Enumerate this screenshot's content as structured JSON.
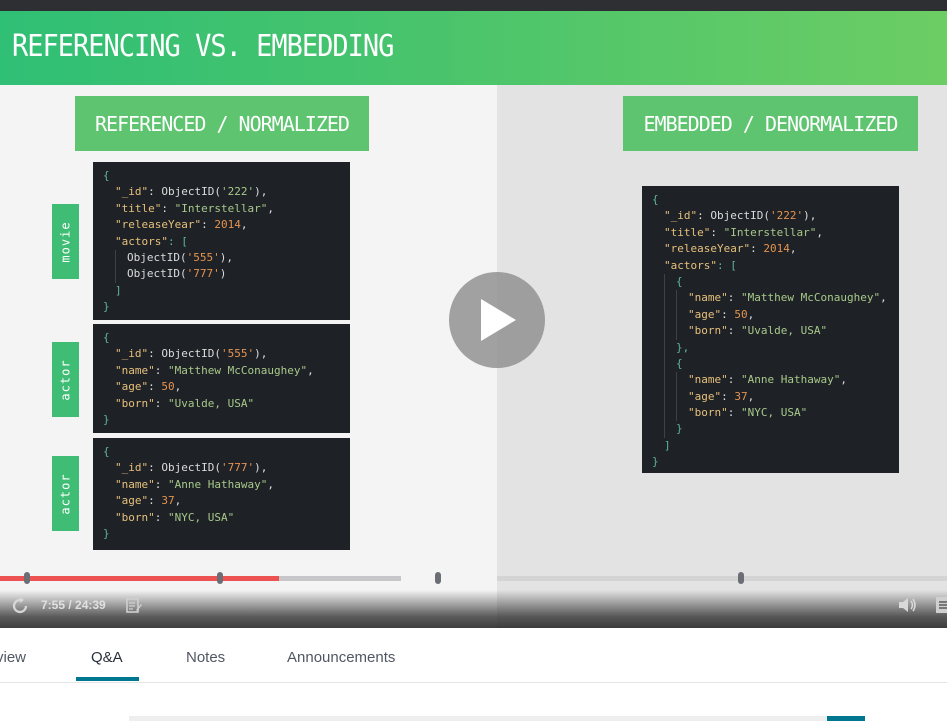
{
  "slide": {
    "title": "REFERENCING VS. EMBEDDING",
    "left_header": "REFERENCED / NORMALIZED",
    "right_header": "EMBEDDED / DENORMALIZED",
    "labels": [
      "movie",
      "actor",
      "actor"
    ]
  },
  "code_blocks": {
    "movie": [
      [
        {
          "t": "{",
          "c": "p"
        }
      ],
      [
        {
          "t": "\"_id\"",
          "c": "k"
        },
        {
          "t": ": ObjectID(",
          "c": "f"
        },
        {
          "t": "'222'",
          "c": "s"
        },
        {
          "t": "),",
          "c": "f"
        }
      ],
      [
        {
          "t": "\"title\"",
          "c": "k"
        },
        {
          "t": ": ",
          "c": "f"
        },
        {
          "t": "\"Interstellar\"",
          "c": "s"
        },
        {
          "t": ",",
          "c": "f"
        }
      ],
      [
        {
          "t": "\"releaseYear\"",
          "c": "k"
        },
        {
          "t": ": ",
          "c": "f"
        },
        {
          "t": "2014",
          "c": "n"
        },
        {
          "t": ",",
          "c": "f"
        }
      ],
      [
        {
          "t": "\"actors\"",
          "c": "k"
        },
        {
          "t": ": [",
          "c": "p"
        }
      ],
      [
        {
          "t": "ObjectID(",
          "c": "f"
        },
        {
          "t": "'555'",
          "c": "n"
        },
        {
          "t": "),",
          "c": "f"
        }
      ],
      [
        {
          "t": "ObjectID(",
          "c": "f"
        },
        {
          "t": "'777'",
          "c": "n"
        },
        {
          "t": ")",
          "c": "f"
        }
      ],
      [
        {
          "t": "]",
          "c": "p"
        }
      ],
      [
        {
          "t": "}",
          "c": "p"
        }
      ]
    ],
    "actor1": [
      [
        {
          "t": "{",
          "c": "p"
        }
      ],
      [
        {
          "t": "\"_id\"",
          "c": "k"
        },
        {
          "t": ": ObjectID(",
          "c": "f"
        },
        {
          "t": "'555'",
          "c": "n"
        },
        {
          "t": "),",
          "c": "f"
        }
      ],
      [
        {
          "t": "\"name\"",
          "c": "k"
        },
        {
          "t": ": ",
          "c": "f"
        },
        {
          "t": "\"Matthew McConaughey\"",
          "c": "s"
        },
        {
          "t": ",",
          "c": "f"
        }
      ],
      [
        {
          "t": "\"age\"",
          "c": "k"
        },
        {
          "t": ": ",
          "c": "f"
        },
        {
          "t": "50",
          "c": "n"
        },
        {
          "t": ",",
          "c": "f"
        }
      ],
      [
        {
          "t": "\"born\"",
          "c": "k"
        },
        {
          "t": ": ",
          "c": "f"
        },
        {
          "t": "\"Uvalde, USA\"",
          "c": "s"
        }
      ],
      [
        {
          "t": "}",
          "c": "p"
        }
      ]
    ],
    "actor2": [
      [
        {
          "t": "{",
          "c": "p"
        }
      ],
      [
        {
          "t": "\"_id\"",
          "c": "k"
        },
        {
          "t": ": ObjectID(",
          "c": "f"
        },
        {
          "t": "'777'",
          "c": "n"
        },
        {
          "t": "),",
          "c": "f"
        }
      ],
      [
        {
          "t": "\"name\"",
          "c": "k"
        },
        {
          "t": ": ",
          "c": "f"
        },
        {
          "t": "\"Anne Hathaway\"",
          "c": "s"
        },
        {
          "t": ",",
          "c": "f"
        }
      ],
      [
        {
          "t": "\"age\"",
          "c": "k"
        },
        {
          "t": ": ",
          "c": "f"
        },
        {
          "t": "37",
          "c": "n"
        },
        {
          "t": ",",
          "c": "f"
        }
      ],
      [
        {
          "t": "\"born\"",
          "c": "k"
        },
        {
          "t": ": ",
          "c": "f"
        },
        {
          "t": "\"NYC, USA\"",
          "c": "s"
        }
      ],
      [
        {
          "t": "}",
          "c": "p"
        }
      ]
    ],
    "embedded": [
      [
        {
          "t": "{",
          "c": "p"
        }
      ],
      [
        {
          "t": "\"_id\"",
          "c": "k"
        },
        {
          "t": ": ObjectID(",
          "c": "f"
        },
        {
          "t": "'222'",
          "c": "n"
        },
        {
          "t": "),",
          "c": "f"
        }
      ],
      [
        {
          "t": "\"title\"",
          "c": "k"
        },
        {
          "t": ": ",
          "c": "f"
        },
        {
          "t": "\"Interstellar\"",
          "c": "s"
        },
        {
          "t": ",",
          "c": "f"
        }
      ],
      [
        {
          "t": "\"releaseYear\"",
          "c": "k"
        },
        {
          "t": ": ",
          "c": "f"
        },
        {
          "t": "2014",
          "c": "n"
        },
        {
          "t": ",",
          "c": "f"
        }
      ],
      [
        {
          "t": "\"actors\"",
          "c": "k"
        },
        {
          "t": ": [",
          "c": "p"
        }
      ],
      [
        {
          "t": "{",
          "c": "p"
        }
      ],
      [
        {
          "t": "\"name\"",
          "c": "k"
        },
        {
          "t": ": ",
          "c": "f"
        },
        {
          "t": "\"Matthew McConaughey\"",
          "c": "s"
        },
        {
          "t": ",",
          "c": "f"
        }
      ],
      [
        {
          "t": "\"age\"",
          "c": "k"
        },
        {
          "t": ": ",
          "c": "f"
        },
        {
          "t": "50",
          "c": "n"
        },
        {
          "t": ",",
          "c": "f"
        }
      ],
      [
        {
          "t": "\"born\"",
          "c": "k"
        },
        {
          "t": ": ",
          "c": "f"
        },
        {
          "t": "\"Uvalde, USA\"",
          "c": "s"
        }
      ],
      [
        {
          "t": "},",
          "c": "p"
        }
      ],
      [
        {
          "t": "{",
          "c": "p"
        }
      ],
      [
        {
          "t": "\"name\"",
          "c": "k"
        },
        {
          "t": ": ",
          "c": "f"
        },
        {
          "t": "\"Anne Hathaway\"",
          "c": "s"
        },
        {
          "t": ",",
          "c": "f"
        }
      ],
      [
        {
          "t": "\"age\"",
          "c": "k"
        },
        {
          "t": ": ",
          "c": "f"
        },
        {
          "t": "37",
          "c": "n"
        },
        {
          "t": ",",
          "c": "f"
        }
      ],
      [
        {
          "t": "\"born\"",
          "c": "k"
        },
        {
          "t": ": ",
          "c": "f"
        },
        {
          "t": "\"NYC, USA\"",
          "c": "s"
        }
      ],
      [
        {
          "t": "}",
          "c": "p"
        }
      ],
      [
        {
          "t": "]",
          "c": "p"
        }
      ],
      [
        {
          "t": "}",
          "c": "p"
        }
      ]
    ]
  },
  "player": {
    "time": "7:55 / 24:39",
    "progress_fraction": 0.295
  },
  "tabs": [
    {
      "label": "view"
    },
    {
      "label": "Q&A",
      "active": true
    },
    {
      "label": "Notes"
    },
    {
      "label": "Announcements"
    }
  ],
  "colors": {
    "banner_start": "#2fbf75",
    "banner_end": "#6ccd64",
    "progress": "#ec5252",
    "active_tab": "#007791"
  }
}
